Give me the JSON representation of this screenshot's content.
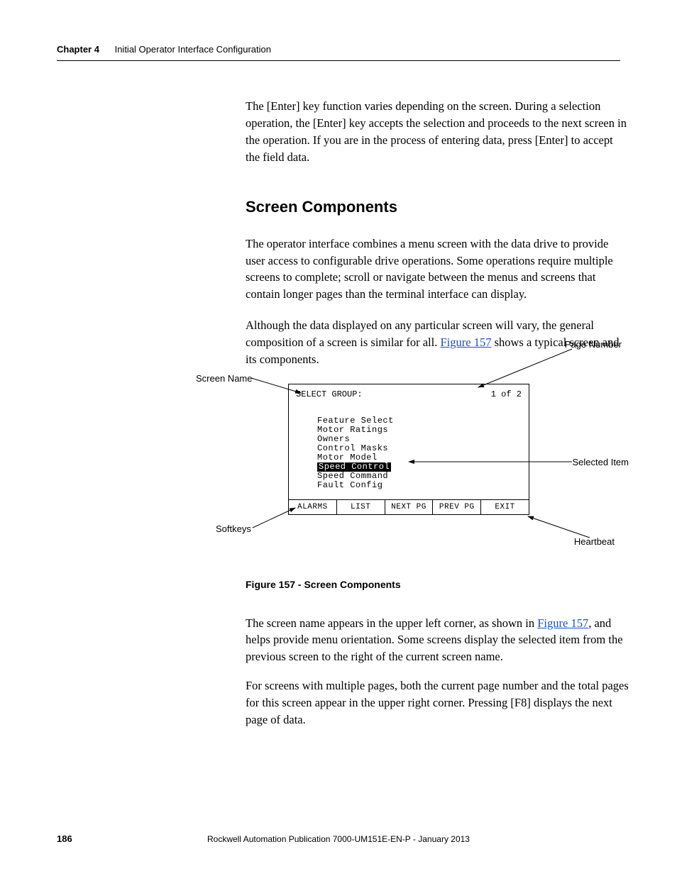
{
  "header": {
    "chapter": "Chapter 4",
    "title": "Initial Operator Interface Configuration"
  },
  "body": {
    "p1": "The [Enter] key function varies depending on the screen. During a selection operation, the [Enter] key accepts the selection and proceeds to the next screen in the operation. If you are in the process of entering data, press [Enter] to accept the field data.",
    "h1": "Screen Components",
    "p2": "The operator interface combines a menu screen with the data drive to provide user access to configurable drive operations. Some operations require multiple screens to complete; scroll or navigate between the menus and screens that contain longer pages than the terminal interface can display.",
    "p3a": "Although the data displayed on any particular screen will vary, the general composition of a screen is similar for all. ",
    "p3link": "Figure 157",
    "p3b": " shows a typical screen and its components."
  },
  "figure": {
    "callouts": {
      "page_number": "Page Number",
      "screen_name": "Screen Name",
      "selected_item": "Selected Item",
      "softkeys": "Softkeys",
      "heartbeat": "Heartbeat"
    },
    "terminal": {
      "title": "SELECT GROUP:",
      "page": "1 of 2",
      "items": [
        "Feature Select",
        "Motor Ratings",
        "Owners",
        "Control Masks",
        "Motor Model",
        "Speed Control",
        "Speed Command",
        "Fault Config"
      ],
      "selected_index": 5,
      "softkeys": [
        "ALARMS",
        "LIST",
        "NEXT PG",
        "PREV PG",
        "EXIT"
      ]
    },
    "caption": "Figure 157 - Screen Components"
  },
  "after": {
    "p4a": "The screen name appears in the upper left corner, as shown in ",
    "p4link": "Figure 157",
    "p4b": ", and helps provide menu orientation. Some screens display the selected item from the previous screen to the right of the current screen name.",
    "p5": "For screens with multiple pages, both the current page number and the total pages for this screen appear in the upper right corner. Pressing [F8] displays the next page of data."
  },
  "footer": {
    "page": "186",
    "pub": "Rockwell Automation Publication 7000-UM151E-EN-P - January 2013"
  }
}
